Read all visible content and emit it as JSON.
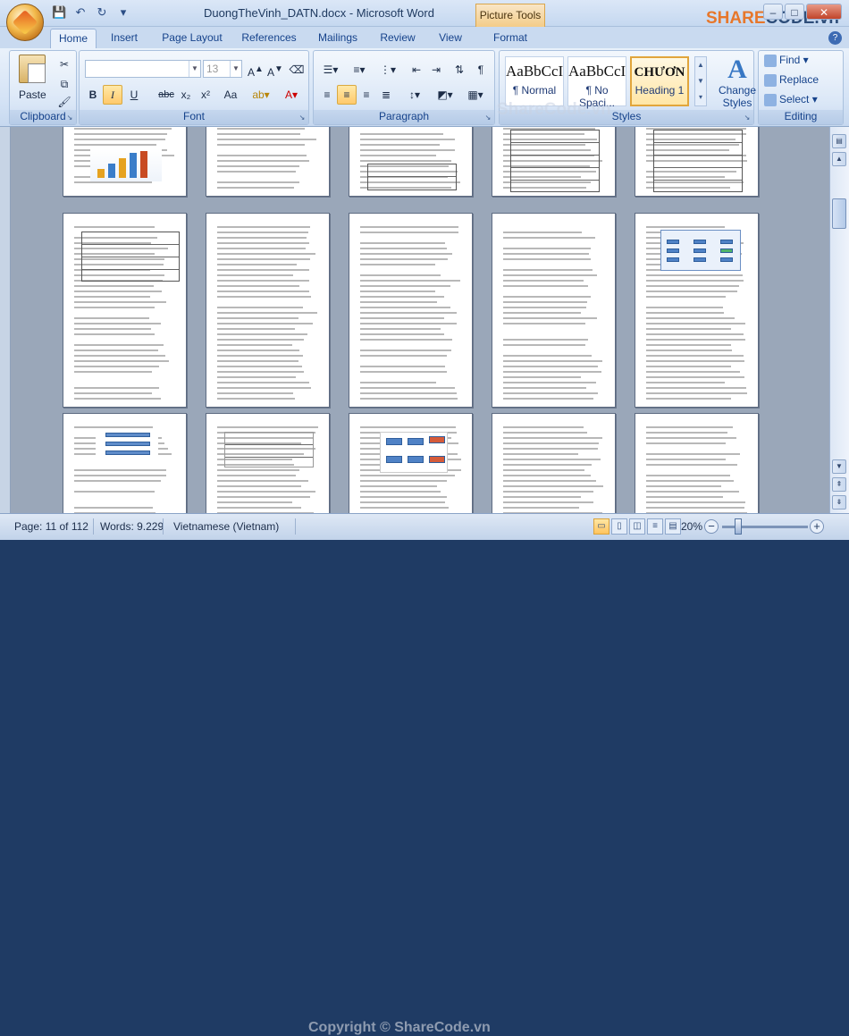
{
  "window": {
    "title": "DuongTheVinh_DATN.docx - Microsoft Word",
    "context_tab": "Picture Tools",
    "controls": [
      "–",
      "□",
      "✕"
    ]
  },
  "tabs": [
    {
      "label": "Home",
      "active": true
    },
    {
      "label": "Insert"
    },
    {
      "label": "Page Layout"
    },
    {
      "label": "References"
    },
    {
      "label": "Mailings"
    },
    {
      "label": "Review"
    },
    {
      "label": "View"
    },
    {
      "label": "Format"
    }
  ],
  "ribbon": {
    "clipboard": {
      "label": "Clipboard",
      "paste": "Paste"
    },
    "font": {
      "label": "Font",
      "font_name": "",
      "font_size": "13",
      "buttons": [
        "B",
        "I",
        "U",
        "abc",
        "x₂",
        "x²",
        "Aa"
      ]
    },
    "paragraph": {
      "label": "Paragraph"
    },
    "styles": {
      "label": "Styles",
      "items": [
        {
          "preview": "AaBbCcI",
          "name": "¶ Normal",
          "active": false
        },
        {
          "preview": "AaBbCcI",
          "name": "¶ No Spaci...",
          "active": false
        },
        {
          "preview": "CHƯƠN",
          "name": "Heading 1",
          "active": true
        }
      ],
      "change_styles": "Change Styles"
    },
    "editing": {
      "label": "Editing",
      "find": "Find",
      "replace": "Replace",
      "select": "Select"
    }
  },
  "status": {
    "page": "Page: 11 of 112",
    "words": "Words: 9.229",
    "language": "Vietnamese (Vietnam)",
    "zoom": "20%"
  },
  "watermarks": {
    "logo_pre": "SHARE",
    "logo_post": "CODE.vn",
    "mid": "ShareCode.vn",
    "bottom": "Copyright © ShareCode.vn"
  }
}
